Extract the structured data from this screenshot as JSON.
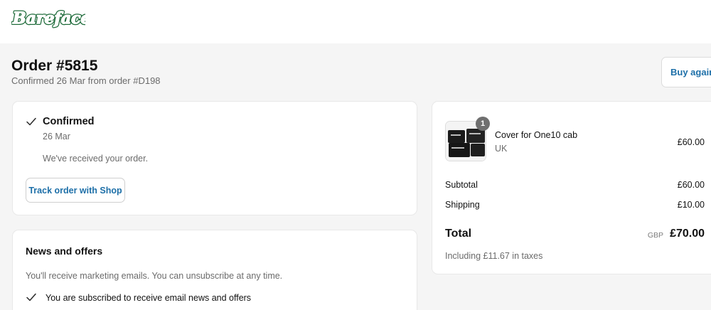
{
  "brand": {
    "logo_text": "Barefaced",
    "logo_color": "#1e6b3a"
  },
  "order": {
    "title": "Order #5815",
    "subtitle": "Confirmed 26 Mar from order #D198"
  },
  "header": {
    "buy_again_label": "Buy again"
  },
  "status": {
    "title": "Confirmed",
    "date": "26 Mar",
    "message": "We've received your order.",
    "track_button_label": "Track order with Shop"
  },
  "news": {
    "title": "News and offers",
    "description": "You'll receive marketing emails. You can unsubscribe at any time.",
    "subscribed_text": "You are subscribed to receive email news and offers"
  },
  "summary": {
    "item": {
      "quantity": "1",
      "name": "Cover for One10 cab",
      "variant": "UK",
      "price": "£60.00"
    },
    "subtotal_label": "Subtotal",
    "subtotal_value": "£60.00",
    "shipping_label": "Shipping",
    "shipping_value": "£10.00",
    "total_label": "Total",
    "total_currency": "GBP",
    "total_value": "£70.00",
    "tax_note": "Including £11.67 in taxes"
  },
  "colors": {
    "accent": "#1d6fa8",
    "muted_text": "#6b6b6b",
    "background": "#f5f5f5"
  },
  "icons": {
    "status_check": "checkmark-icon",
    "subscribed_check": "checkmark-icon"
  }
}
